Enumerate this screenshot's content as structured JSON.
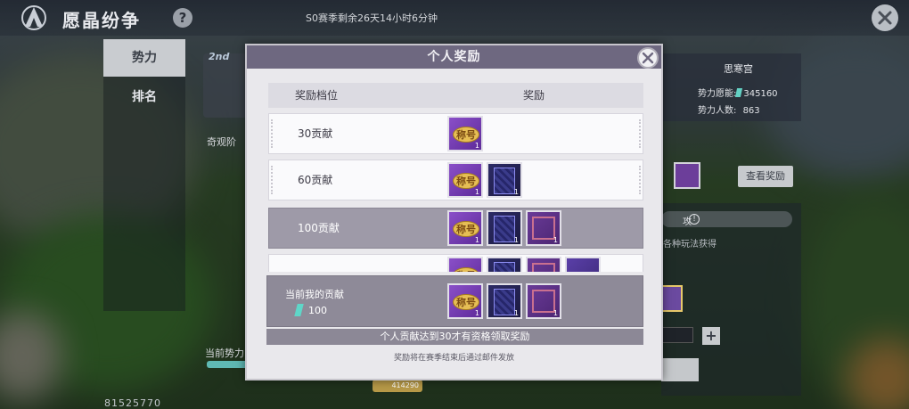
{
  "app": {
    "title": "愿晶纷争",
    "help_label": "?",
    "season_timer": "S0赛季剩余26天14小时6分钟"
  },
  "side_tabs": [
    {
      "label": "势力"
    },
    {
      "label": "排名"
    }
  ],
  "background": {
    "rank_tag": "2nd",
    "wonder_stage_label": "奇观阶",
    "current_faction_label": "当前势力",
    "current_faction_progress": 0.35,
    "bottom_number": "81525770",
    "coin_value": "414290",
    "faction": {
      "name": "思寒宫",
      "crystal_label": "势力愿能:",
      "crystal_value": "345160",
      "members_label": "势力人数:",
      "members_value": "863"
    },
    "view_reward_button": "查看奖励",
    "right_strip_text": "攻",
    "right_hint": "各种玩法获得",
    "plus_label": "+"
  },
  "modal": {
    "title": "个人奖励",
    "col_tier": "奖励档位",
    "col_reward": "奖励",
    "rows": [
      {
        "label": "30贡献",
        "items": [
          {
            "type": "title",
            "text": "称号",
            "qty": "1"
          }
        ]
      },
      {
        "label": "60贡献",
        "items": [
          {
            "type": "title",
            "text": "称号",
            "qty": "1"
          },
          {
            "type": "frame",
            "qty": "1"
          }
        ]
      },
      {
        "label": "100贡献",
        "items": [
          {
            "type": "title",
            "text": "称号",
            "qty": "1"
          },
          {
            "type": "frame",
            "qty": "1"
          },
          {
            "type": "box",
            "qty": "1"
          }
        ]
      },
      {
        "label": "",
        "items": [
          {
            "type": "title",
            "text": "称号",
            "qty": ""
          },
          {
            "type": "frame",
            "qty": ""
          },
          {
            "type": "box",
            "qty": ""
          },
          {
            "type": "plain",
            "qty": ""
          }
        ]
      }
    ],
    "current": {
      "label": "当前我的贡献",
      "value": "100",
      "items": [
        {
          "type": "title",
          "text": "称号",
          "qty": "1"
        },
        {
          "type": "frame",
          "qty": "1"
        },
        {
          "type": "box",
          "qty": "1"
        }
      ]
    },
    "notice": "个人贡献达到30才有资格领取奖励",
    "footnote": "奖励将在赛季结束后通过邮件发放"
  },
  "colors": {
    "modal_header": "#6e6880",
    "highlight_row": "#9e9aa8",
    "title_badge": "#e6be55",
    "crystal": "#5fd6c8"
  },
  "icons": [
    "logo-icon",
    "help-icon",
    "close-icon",
    "crystal-icon",
    "info-icon",
    "plus-icon"
  ]
}
